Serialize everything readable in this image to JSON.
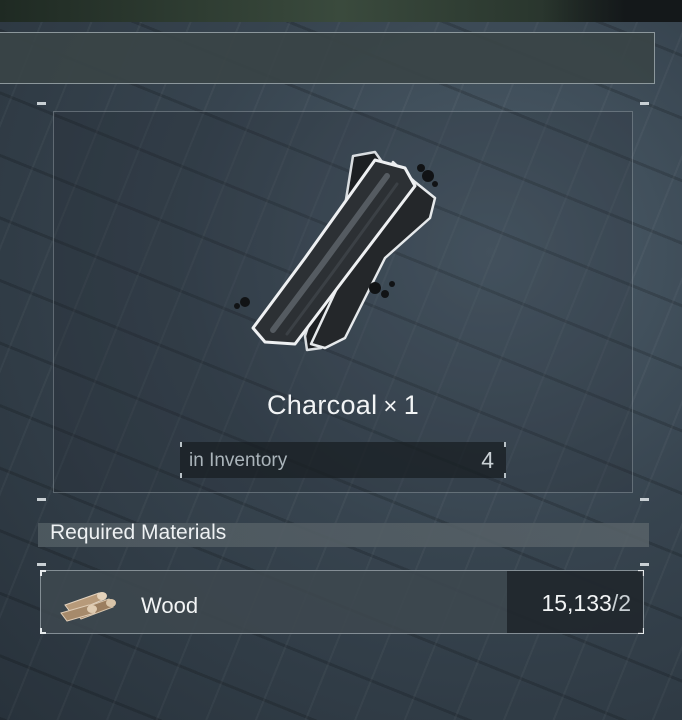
{
  "item": {
    "name": "Charcoal",
    "multiplier": "×",
    "quantity": "1",
    "icon": "charcoal-icon"
  },
  "inventory": {
    "label": "in Inventory",
    "count": "4"
  },
  "required": {
    "header": "Required Materials",
    "materials": [
      {
        "name": "Wood",
        "icon": "wood-icon",
        "owned": "15,133",
        "separator": "/",
        "needed": "2"
      }
    ]
  },
  "colors": {
    "panel_border": "#c9d0d4",
    "text": "#eef1f3",
    "muted_text": "#aab4ba"
  }
}
